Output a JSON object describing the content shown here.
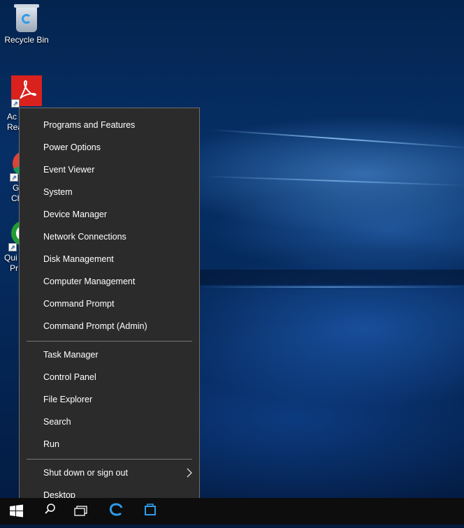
{
  "desktop": {
    "icons": [
      {
        "label": "Recycle Bin",
        "icon": "recycle-bin-icon"
      },
      {
        "label_lines": [
          "Ac",
          "Rea"
        ],
        "icon": "acrobat-reader-icon"
      },
      {
        "label_lines": [
          "G",
          "Ch"
        ],
        "icon": "chrome-icon"
      },
      {
        "label_lines": [
          "Qui",
          "Pr"
        ],
        "icon": "quicktime-icon"
      }
    ]
  },
  "menu": {
    "group1": [
      {
        "label": "Programs and Features"
      },
      {
        "label": "Power Options"
      },
      {
        "label": "Event Viewer"
      },
      {
        "label": "System"
      },
      {
        "label": "Device Manager"
      },
      {
        "label": "Network Connections"
      },
      {
        "label": "Disk Management"
      },
      {
        "label": "Computer Management"
      },
      {
        "label": "Command Prompt"
      },
      {
        "label": "Command Prompt (Admin)"
      }
    ],
    "group2": [
      {
        "label": "Task Manager"
      },
      {
        "label": "Control Panel"
      },
      {
        "label": "File Explorer"
      },
      {
        "label": "Search"
      },
      {
        "label": "Run"
      }
    ],
    "group3": [
      {
        "label": "Shut down or sign out",
        "submenu_icon": "chevron-right-icon"
      },
      {
        "label": "Desktop"
      }
    ]
  },
  "taskbar": {
    "buttons": [
      "windows-start-icon",
      "search-icon",
      "task-view-icon",
      "edge-icon",
      "store-icon"
    ]
  },
  "colors": {
    "menu_bg": "#2b2b2b",
    "menu_text": "#ffffff",
    "taskbar_bg": "#0d0d0d",
    "accent_blue": "#2f9be8"
  }
}
